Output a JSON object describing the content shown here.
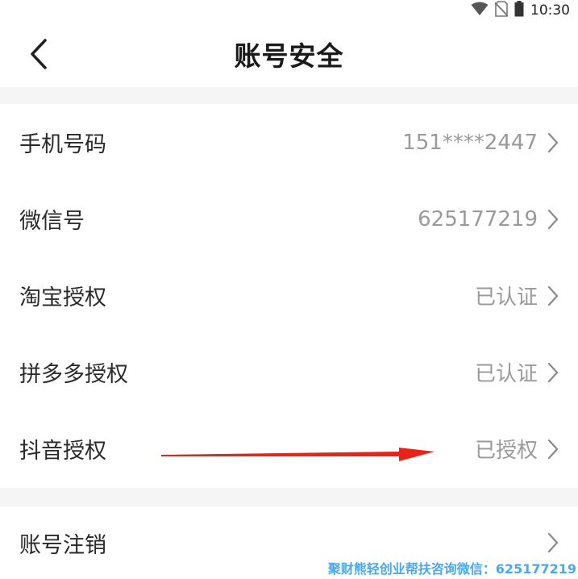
{
  "status_bar": {
    "time": "10:30",
    "icons": [
      "wifi-icon",
      "no-sim-icon",
      "battery-icon"
    ]
  },
  "header": {
    "title": "账号安全",
    "back_icon": "chevron-left-icon"
  },
  "settings": {
    "items": [
      {
        "label": "手机号码",
        "value": "151****2447"
      },
      {
        "label": "微信号",
        "value": "625177219"
      },
      {
        "label": "淘宝授权",
        "value": "已认证"
      },
      {
        "label": "拼多多授权",
        "value": "已认证"
      },
      {
        "label": "抖音授权",
        "value": "已授权"
      }
    ],
    "account_cancel": {
      "label": "账号注销"
    }
  },
  "watermark": "聚财熊轻创业帮扶咨询微信：625177219",
  "colors": {
    "background": "#f5f5f5",
    "card": "#ffffff",
    "value_text": "#9a9a9a",
    "annotation_arrow": "#e8231a",
    "watermark": "#4aa8f0"
  }
}
